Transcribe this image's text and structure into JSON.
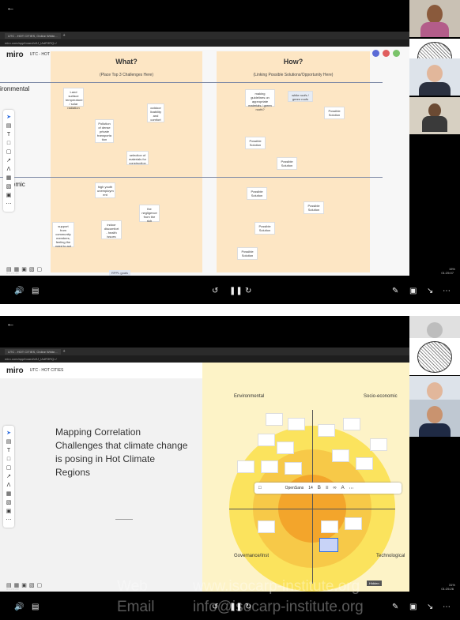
{
  "top": {
    "back_icon": "arrow-left-icon",
    "tab_title": "UTC - HOT CITIES, Online White...",
    "url": "miro.com/app/board/o9J_lAdR3RQ=/",
    "app_logo": "miro",
    "board_name": "UTC - HOT CITIES",
    "what_title": "What?",
    "what_sub": "(Place Top 3 Challenges Here)",
    "how_title": "How?",
    "how_sub": "(Linking Possible Solutions/Opportunity Here)",
    "row_environmental": "ironmental",
    "row_economic": "onomic",
    "notes_what": [
      "Land surface temperature / solar radiation",
      "outdoor livability and comfort",
      "Pollution of dense private transporta tion",
      "selection of materials for construction",
      "high youth unemploym ent",
      "the negligence from the rich",
      "support from community members, feeling the need to act",
      "indoor discomfort - health issues"
    ],
    "notes_how": [
      "making guidelines on appropriate materials / green roofs?",
      "white roofs / green roofs",
      "Possible Solution",
      "Possible Solution",
      "Possible Solution",
      "Possible Solution",
      "Possible Solution",
      "Possible Solution",
      "Possible Solution"
    ],
    "bottom_label": "RPPL goals",
    "zoom": "15%",
    "time_elapsed": "01:24:35",
    "time_total": "01:25:07"
  },
  "bottom": {
    "tab_title": "UTC - HOT CITIES, Online White...",
    "url": "miro.com/app/board/o9J_lAdR3RQ=/",
    "app_logo": "miro",
    "board_name": "UTC - HOT CITIES",
    "slide_title": "Mapping Correlation Challenges that climate change is posing in Hot Climate Regions",
    "quadrants": [
      "Environmental",
      "Socio-economic",
      "Governance/Inst",
      "Technological"
    ],
    "toolbar_font": "OpenSans",
    "toolbar_size": "14",
    "zoom": "31%",
    "time_elapsed": "01:23:28",
    "time_total": "01:25:26",
    "hidden_label": "Hidden"
  },
  "controls": {
    "volume_icon": "speaker-icon",
    "captions_icon": "captions-icon",
    "rewind_icon": "rewind-10-icon",
    "pause_icon": "pause-icon",
    "forward_icon": "forward-30-icon",
    "edit_icon": "pencil-icon",
    "pip_icon": "picture-in-picture-icon",
    "fullscreen_icon": "exit-fullscreen-icon",
    "more_icon": "more-icon"
  },
  "watermark": {
    "web_label": "Web",
    "web_value": "www.isocarp-institute.org",
    "email_label": "Email",
    "email_value": "info@isocarp-institute.org"
  },
  "colors": {
    "note_orange": "#fde6c4",
    "ring_outer": "#fbe35d",
    "ring_mid": "#f7c948",
    "ring_inner": "#f3a52b",
    "accent": "#2d6cdf"
  }
}
